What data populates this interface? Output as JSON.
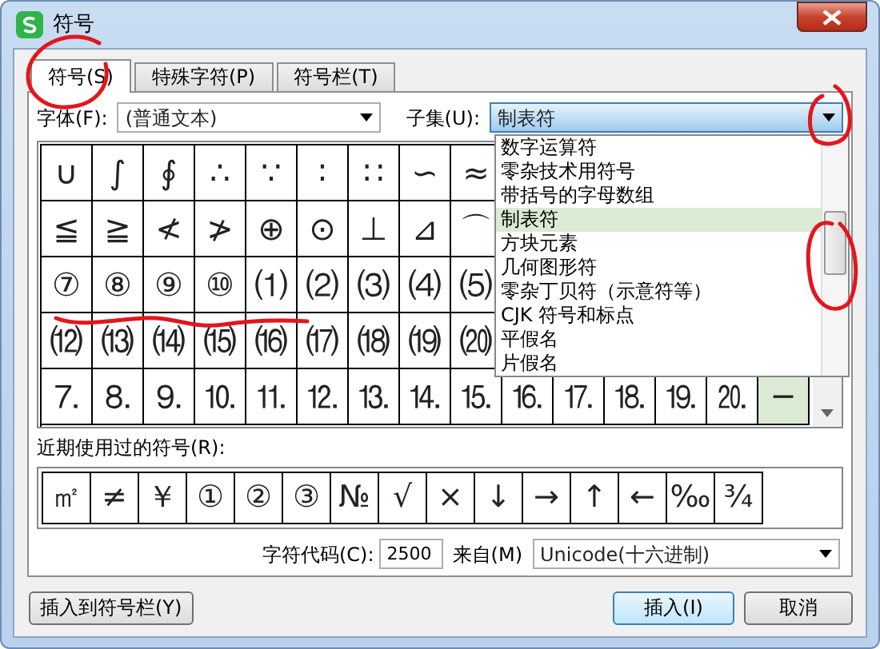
{
  "window": {
    "title": "符号"
  },
  "tabs": [
    {
      "label": "符号(S)",
      "selected": true
    },
    {
      "label": "特殊字符(P)",
      "selected": false
    },
    {
      "label": "符号栏(T)",
      "selected": false
    }
  ],
  "font": {
    "label": "字体(F):",
    "value": "(普通文本)"
  },
  "subset": {
    "label": "子集(U):",
    "value": "制表符",
    "expanded": true,
    "options": [
      {
        "label": "数字运算符",
        "selected": false
      },
      {
        "label": "零杂技术用符号",
        "selected": false
      },
      {
        "label": "带括号的字母数组",
        "selected": false
      },
      {
        "label": "制表符",
        "selected": true
      },
      {
        "label": "方块元素",
        "selected": false
      },
      {
        "label": "几何图形符",
        "selected": false
      },
      {
        "label": "零杂丁贝符（示意符等）",
        "selected": false
      },
      {
        "label": "CJK 符号和标点",
        "selected": false
      },
      {
        "label": "平假名",
        "selected": false
      },
      {
        "label": "片假名",
        "selected": false
      }
    ]
  },
  "symbol_grid": {
    "rows": [
      {
        "cells": [
          {
            "char": "∪",
            "selected": false
          },
          {
            "char": "∫",
            "selected": false
          },
          {
            "char": "∮",
            "selected": false
          },
          {
            "char": "∴",
            "selected": false
          },
          {
            "char": "∵",
            "selected": false
          },
          {
            "char": "∶",
            "selected": false
          },
          {
            "char": "∷",
            "selected": false
          },
          {
            "char": "∽",
            "selected": false
          },
          {
            "char": "≈",
            "selected": false
          }
        ]
      },
      {
        "cells": [
          {
            "char": "≦",
            "selected": false
          },
          {
            "char": "≧",
            "selected": false
          },
          {
            "char": "≮",
            "selected": false
          },
          {
            "char": "≯",
            "selected": false
          },
          {
            "char": "⊕",
            "selected": false
          },
          {
            "char": "⊙",
            "selected": false
          },
          {
            "char": "⊥",
            "selected": false
          },
          {
            "char": "⊿",
            "selected": false
          },
          {
            "char": "⌒",
            "selected": false
          }
        ]
      },
      {
        "cells": [
          {
            "char": "⑦",
            "selected": false
          },
          {
            "char": "⑧",
            "selected": false
          },
          {
            "char": "⑨",
            "selected": false
          },
          {
            "char": "⑩",
            "selected": false
          },
          {
            "char": "⑴",
            "selected": false
          },
          {
            "char": "⑵",
            "selected": false
          },
          {
            "char": "⑶",
            "selected": false
          },
          {
            "char": "⑷",
            "selected": false
          },
          {
            "char": "⑸",
            "selected": false
          }
        ]
      },
      {
        "cells": [
          {
            "char": "⑿",
            "selected": false
          },
          {
            "char": "⒀",
            "selected": false
          },
          {
            "char": "⒁",
            "selected": false
          },
          {
            "char": "⒂",
            "selected": false
          },
          {
            "char": "⒃",
            "selected": false
          },
          {
            "char": "⒄",
            "selected": false
          },
          {
            "char": "⒅",
            "selected": false
          },
          {
            "char": "⒆",
            "selected": false
          },
          {
            "char": "⒇",
            "selected": false
          }
        ]
      },
      {
        "cells": [
          {
            "char": "⒎",
            "selected": false
          },
          {
            "char": "⒏",
            "selected": false
          },
          {
            "char": "⒐",
            "selected": false
          },
          {
            "char": "⒑",
            "selected": false
          },
          {
            "char": "⒒",
            "selected": false
          },
          {
            "char": "⒓",
            "selected": false
          },
          {
            "char": "⒔",
            "selected": false
          },
          {
            "char": "⒕",
            "selected": false
          },
          {
            "char": "⒖",
            "selected": false
          },
          {
            "char": "⒗",
            "selected": false
          },
          {
            "char": "⒘",
            "selected": false
          },
          {
            "char": "⒙",
            "selected": false
          },
          {
            "char": "⒚",
            "selected": false
          },
          {
            "char": "⒛",
            "selected": false
          },
          {
            "char": "─",
            "selected": true
          }
        ]
      }
    ]
  },
  "recent": {
    "label": "近期使用过的符号(R):",
    "symbols": [
      "㎡",
      "≠",
      "￥",
      "①",
      "②",
      "③",
      "№",
      "√",
      "×",
      "↓",
      "→",
      "↑",
      "←",
      "‰",
      "¾"
    ]
  },
  "char_code": {
    "label": "字符代码(C):",
    "value": "2500"
  },
  "source": {
    "label": "来自(M)",
    "value": "Unicode(十六进制)"
  },
  "buttons": [
    {
      "label": "插入到符号栏(Y)",
      "default": false
    },
    {
      "label": "插入(I)",
      "default": true
    },
    {
      "label": "取消",
      "default": false
    }
  ],
  "annotations": [
    {
      "kind": "circle"
    },
    {
      "kind": "circle"
    },
    {
      "kind": "circle"
    },
    {
      "kind": "underline"
    }
  ]
}
